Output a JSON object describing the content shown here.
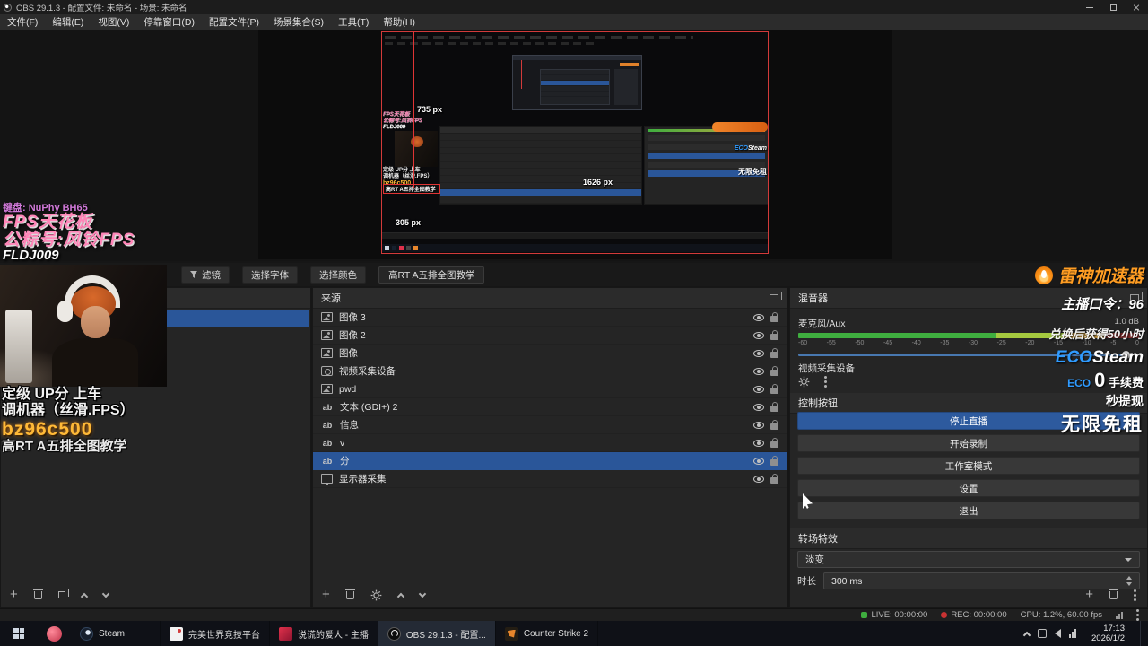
{
  "titlebar": {
    "title": "OBS 29.1.3 - 配置文件: 未命名 - 场景: 未命名"
  },
  "menubar": {
    "items": [
      "文件(F)",
      "编辑(E)",
      "视图(V)",
      "停靠窗口(D)",
      "配置文件(P)",
      "场景集合(S)",
      "工具(T)",
      "帮助(H)"
    ]
  },
  "preview": {
    "labels": {
      "w1": "735 px",
      "w2": "1626 px",
      "w3": "305 px"
    }
  },
  "overlay_left": {
    "line1": "键盘: NuPhy BH65",
    "line2": "FPS天花板",
    "line3": "公粽号:风铃FPS",
    "line4": "FLDJ009"
  },
  "overlay_cam": {
    "line1": "定级 UP分 上车",
    "line2": "调机器（丝滑.FPS）",
    "line3": "bz96c500",
    "line4": "高RT A五排全图教学"
  },
  "overlay_right": {
    "brand": "雷神加速器",
    "slogan1": "主播口令：96",
    "slogan2": "兑换后获得50小时",
    "eco_blue": "ECO",
    "eco_white": "Steam",
    "eco_small": "ECO",
    "fee_num": "0",
    "fee_text": "手续费",
    "line_withdraw": "秒提现",
    "line_free": "无限免租"
  },
  "dock_toolbar": {
    "filter": "滤镜",
    "font": "选择字体",
    "color": "选择颜色",
    "text_value": "高RT A五排全图教学"
  },
  "icons": {
    "text_glyph": "ab"
  },
  "sources": {
    "title": "来源",
    "items": [
      {
        "label": "图像 3",
        "type": "image"
      },
      {
        "label": "图像 2",
        "type": "image"
      },
      {
        "label": "图像",
        "type": "image"
      },
      {
        "label": "视频采集设备",
        "type": "camera"
      },
      {
        "label": "pwd",
        "type": "image"
      },
      {
        "label": "文本 (GDI+) 2",
        "type": "text"
      },
      {
        "label": "信息",
        "type": "text"
      },
      {
        "label": "v",
        "type": "text"
      },
      {
        "label": "分",
        "type": "text"
      },
      {
        "label": "显示器采集",
        "type": "monitor"
      }
    ]
  },
  "mixer": {
    "title": "混音器",
    "mic": "麦克风/Aux",
    "db": "1.0 dB",
    "ticks": [
      "-60",
      "-55",
      "-50",
      "-45",
      "-40",
      "-35",
      "-30",
      "-25",
      "-20",
      "-15",
      "-10",
      "-5",
      "0"
    ],
    "device": "视频采集设备"
  },
  "controls": {
    "title": "控制按钮",
    "stop_stream": "停止直播",
    "start_rec": "开始录制",
    "studio_mode": "工作室模式",
    "settings": "设置",
    "exit": "退出"
  },
  "transitions": {
    "title": "转场特效",
    "value": "淡变",
    "duration_label": "时长",
    "duration": "300 ms"
  },
  "statusbar": {
    "live": "LIVE: 00:00:00",
    "rec": "REC: 00:00:00",
    "cpu": "CPU: 1.2%, 60.00 fps"
  },
  "taskbar": {
    "apps": [
      {
        "label": "Steam"
      },
      {
        "label": "完美世界竞技平台"
      },
      {
        "label": "说谎的爱人 - 主播"
      },
      {
        "label": "OBS 29.1.3 - 配置..."
      },
      {
        "label": "Counter Strike 2"
      }
    ],
    "time": "17:13",
    "date": "2026/1/2"
  }
}
